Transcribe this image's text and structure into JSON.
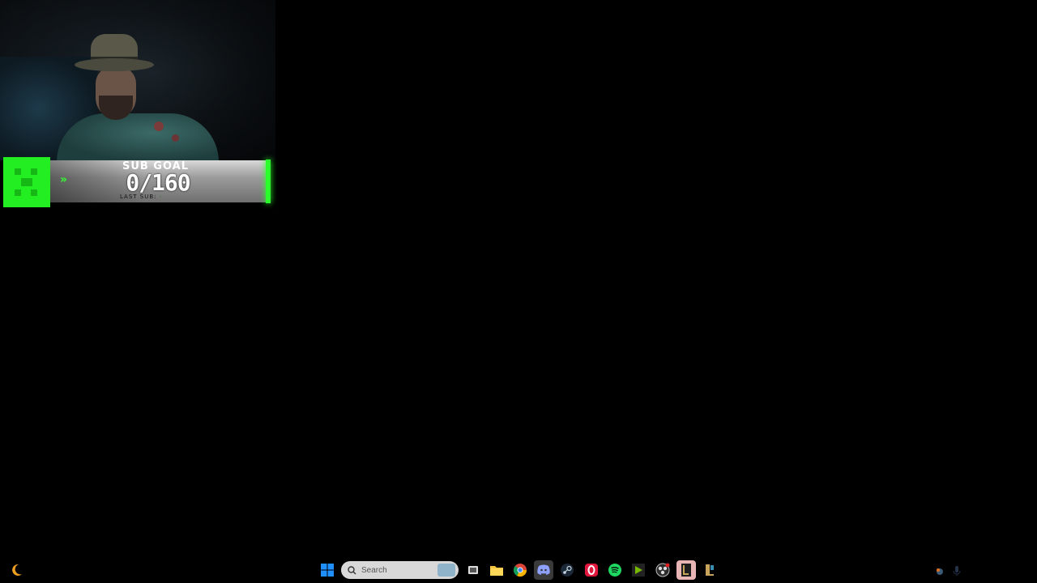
{
  "subgoal": {
    "title": "SUB GOAL",
    "count": "0/160",
    "last_label": "LAST SUB: ",
    "last_value": "-",
    "accent": "#22ee22"
  },
  "taskbar": {
    "search_placeholder": "Search",
    "icons": [
      "weather-moon-icon",
      "windows-start-icon",
      "search-icon",
      "task-view-icon",
      "file-explorer-icon",
      "chrome-icon",
      "discord-icon",
      "steam-icon",
      "opera-gx-icon",
      "spotify-icon",
      "nvidia-icon",
      "obs-icon",
      "league-client-icon",
      "league-icon"
    ],
    "tray": [
      "network-icon",
      "microphone-icon"
    ]
  }
}
